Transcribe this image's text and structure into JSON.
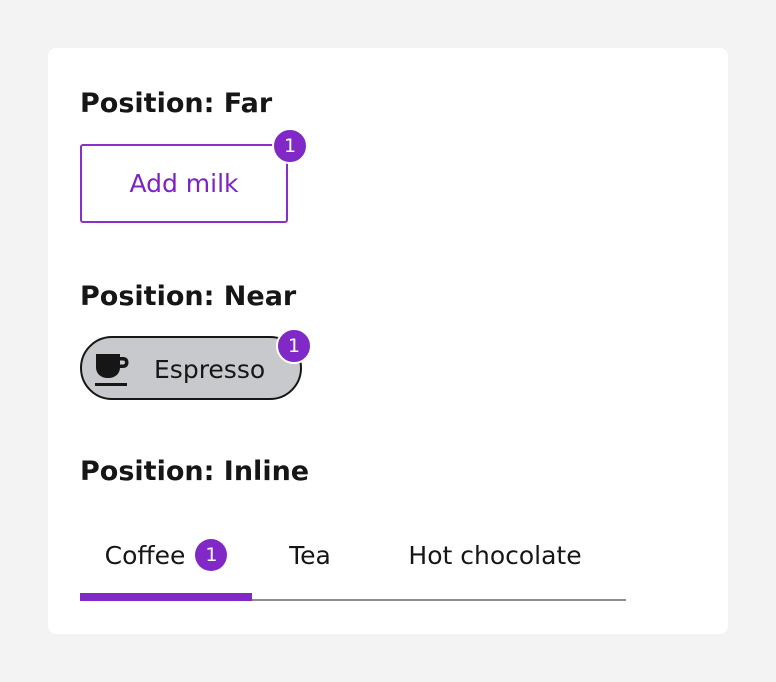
{
  "far": {
    "title": "Position: Far",
    "button_label": "Add milk",
    "badge_count": "1"
  },
  "near": {
    "title": "Position: Near",
    "chip_label": "Espresso",
    "chip_icon": "coffee-cup-icon",
    "badge_count": "1"
  },
  "inline": {
    "title": "Position: Inline",
    "tabs": [
      {
        "label": "Coffee",
        "badge_count": "1",
        "selected": true
      },
      {
        "label": "Tea",
        "selected": false
      },
      {
        "label": "Hot chocolate",
        "selected": false
      }
    ]
  },
  "colors": {
    "accent": "#8029c6",
    "page_background": "#f3f3f3",
    "card_background": "#ffffff",
    "chip_background": "#c8c9cd",
    "text": "#161616"
  }
}
